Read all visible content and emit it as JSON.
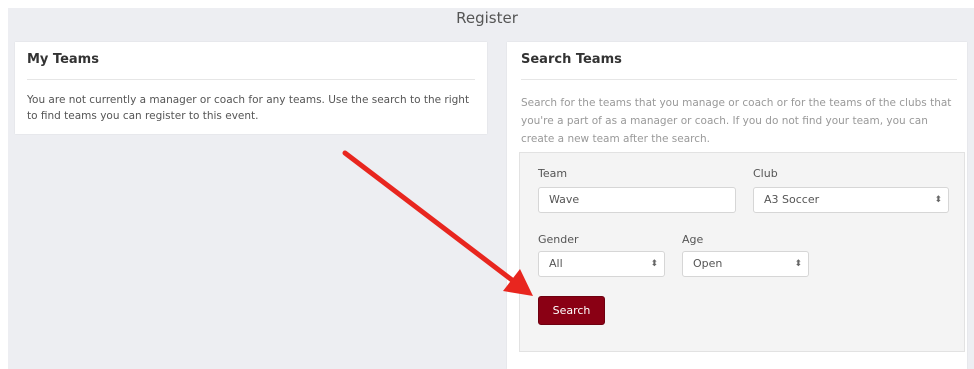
{
  "page": {
    "title": "Register"
  },
  "my_teams": {
    "title": "My Teams",
    "message": "You are not currently a manager or coach for any teams. Use the search to the right to find teams you can register to this event."
  },
  "search_teams": {
    "title": "Search Teams",
    "description": "Search for the teams that you manage or coach or for the teams of the clubs that you're a part of as a manager or coach. If you do not find your team, you can create a new team after the search.",
    "team": {
      "label": "Team",
      "value": "Wave"
    },
    "club": {
      "label": "Club",
      "value": "A3 Soccer"
    },
    "gender": {
      "label": "Gender",
      "value": "All"
    },
    "age": {
      "label": "Age",
      "value": "Open"
    },
    "search_button": "Search"
  },
  "colors": {
    "accent": "#8a0014",
    "annotation_arrow": "#e8261f",
    "background": "#edeef2"
  },
  "icons": [
    "select-arrows-icon",
    "annotation-arrow-icon"
  ]
}
